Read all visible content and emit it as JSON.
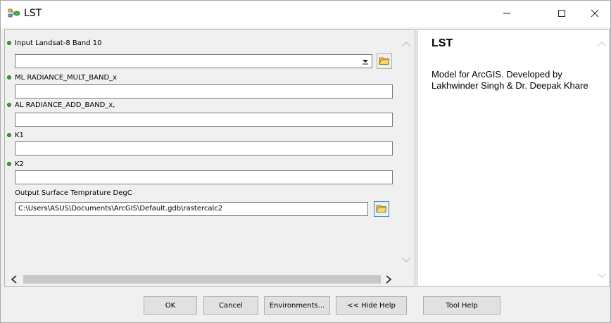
{
  "window": {
    "title": "LST",
    "icons": {
      "app": "model-icon",
      "minimize": "minimize-icon",
      "maximize": "maximize-icon",
      "close": "close-icon"
    }
  },
  "parameters": [
    {
      "label": "Input Landsat-8 Band 10",
      "required": true,
      "type": "dropdown",
      "value": ""
    },
    {
      "label": "ML RADIANCE_MULT_BAND_x",
      "required": true,
      "type": "text",
      "value": ""
    },
    {
      "label": "AL RADIANCE_ADD_BAND_x,",
      "required": true,
      "type": "text",
      "value": ""
    },
    {
      "label": "K1",
      "required": true,
      "type": "text",
      "value": ""
    },
    {
      "label": "K2",
      "required": true,
      "type": "text",
      "value": ""
    },
    {
      "label": "Output Surface Temprature DegC",
      "required": false,
      "type": "text",
      "value": "C:\\Users\\ASUS\\Documents\\ArcGIS\\Default.gdb\\rastercalc2"
    }
  ],
  "help": {
    "title": "LST",
    "body": "Model for ArcGIS. Developed by Lakhwinder Singh & Dr. Deepak Khare"
  },
  "buttons": {
    "ok": "OK",
    "cancel": "Cancel",
    "environments": "Environments...",
    "hide_help": "<< Hide Help",
    "tool_help": "Tool Help"
  },
  "colors": {
    "required_dot": "#2ea82e",
    "panel_bg": "#f0f0f0",
    "focus_border": "#3c7fb1"
  }
}
